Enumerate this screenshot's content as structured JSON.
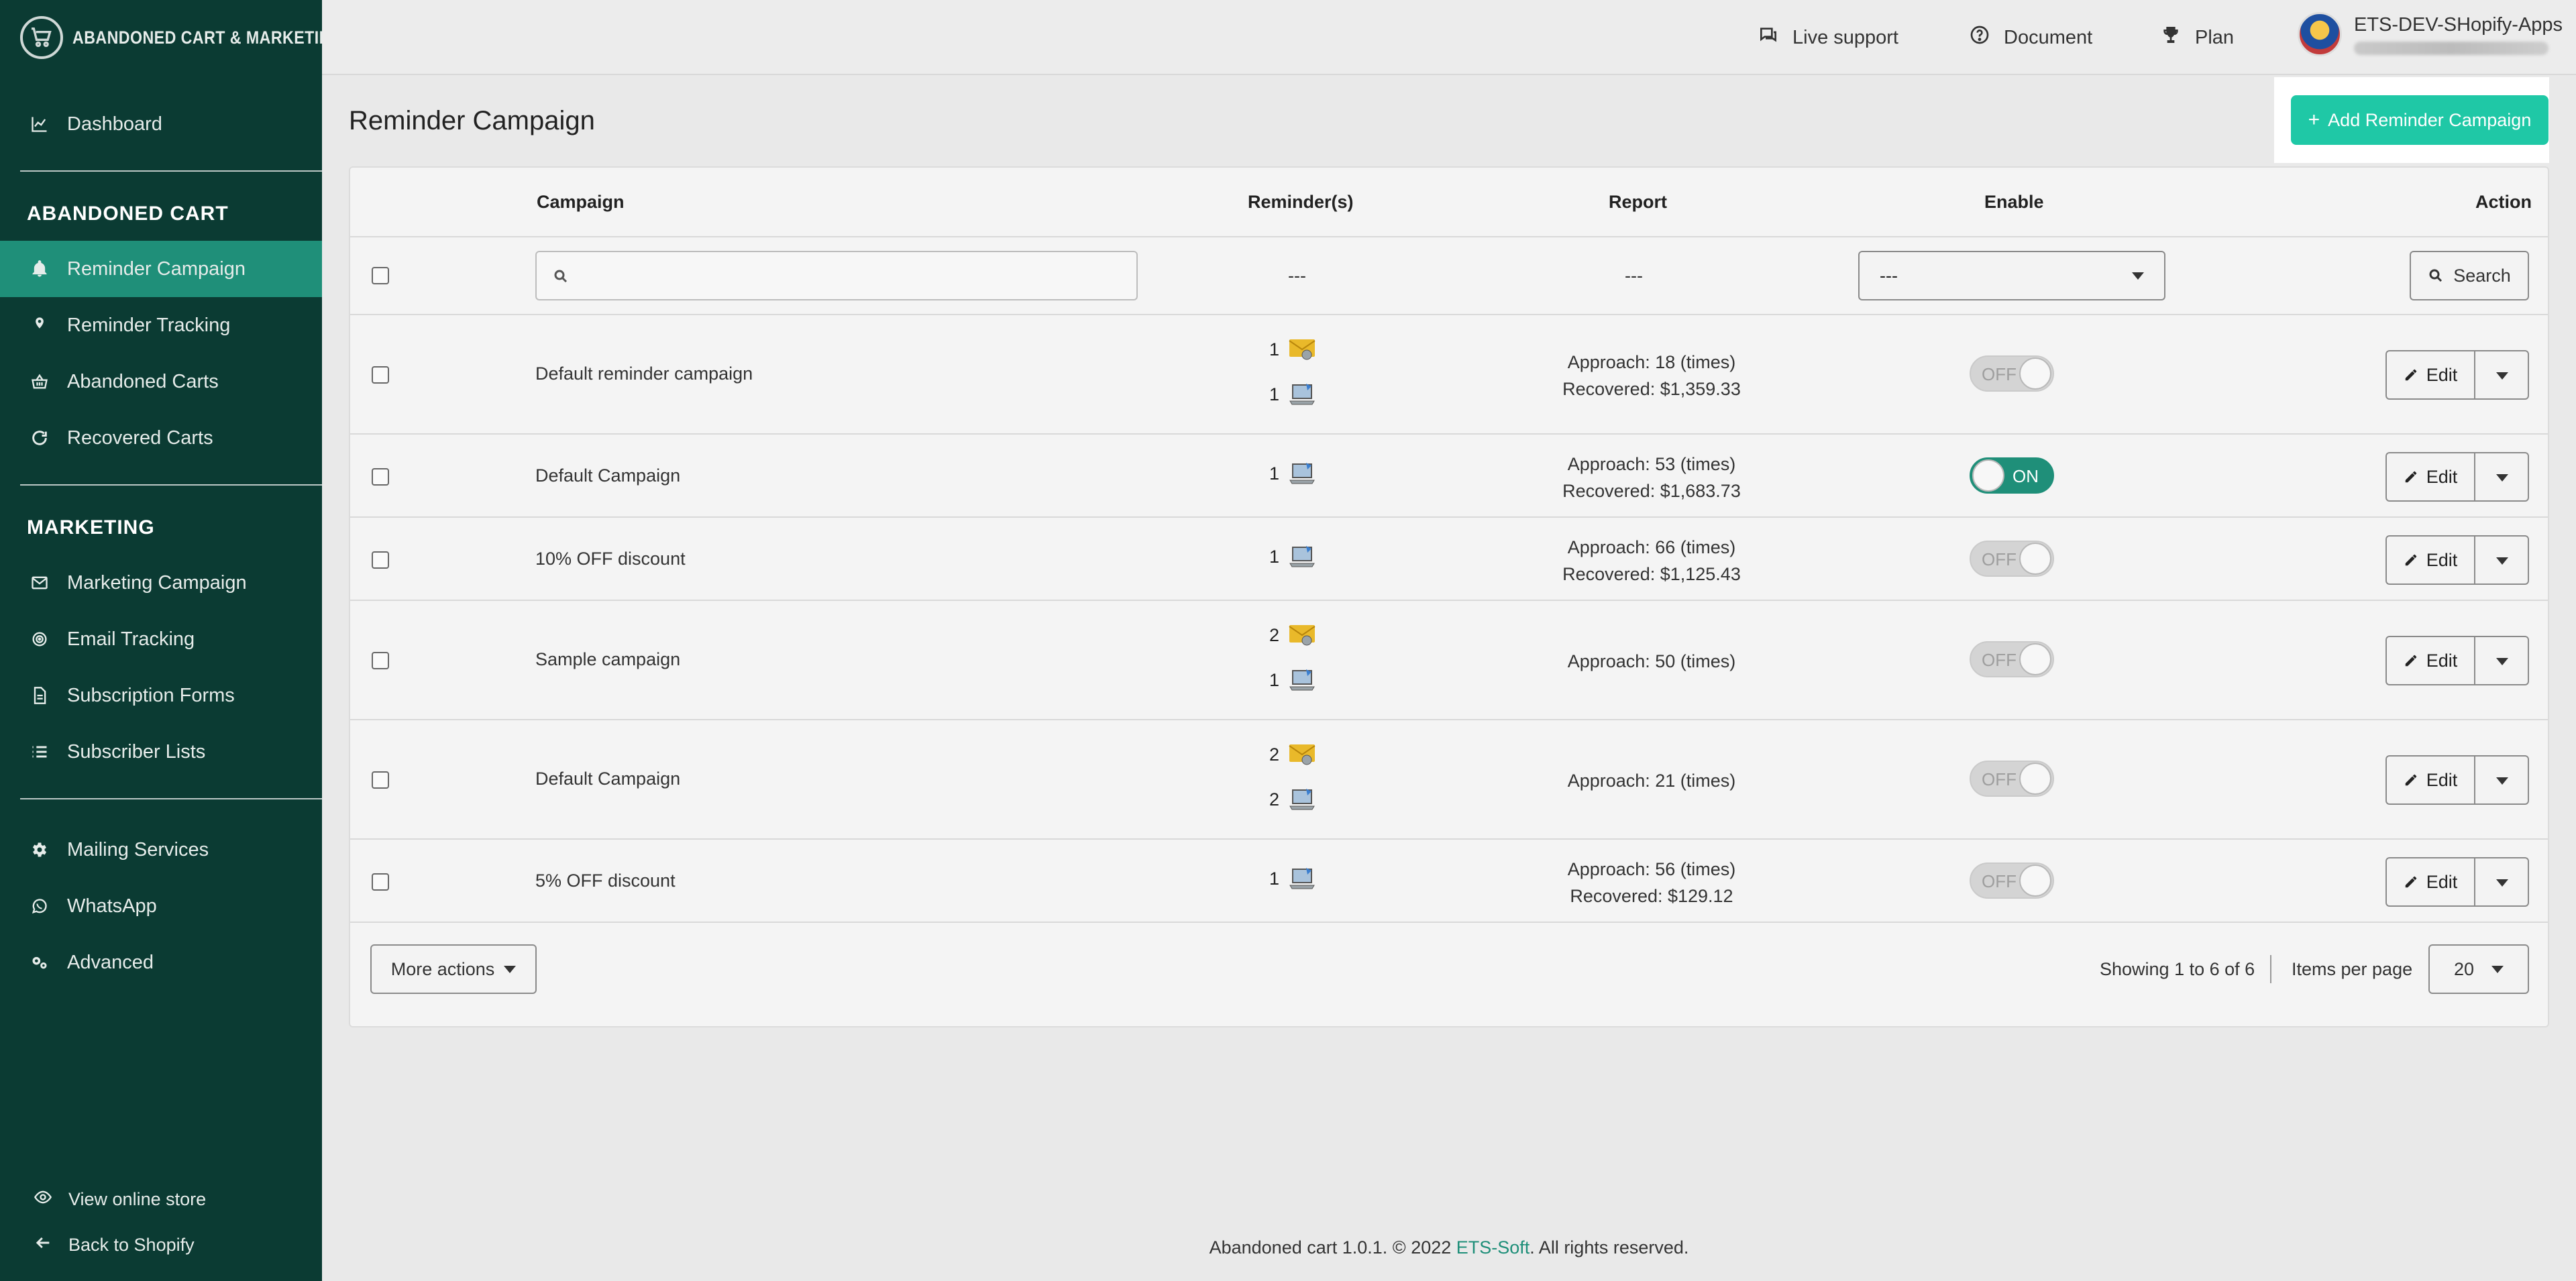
{
  "brand": {
    "name": "ABANDONED CART & MARKETING"
  },
  "sidebar": {
    "dashboard": "Dashboard",
    "section_cart": "ABANDONED CART",
    "cart_items": [
      "Reminder Campaign",
      "Reminder Tracking",
      "Abandoned Carts",
      "Recovered Carts"
    ],
    "section_marketing": "MARKETING",
    "marketing_items": [
      "Marketing Campaign",
      "Email Tracking",
      "Subscription Forms",
      "Subscriber Lists"
    ],
    "other_items": [
      "Mailing Services",
      "WhatsApp",
      "Advanced"
    ],
    "footer": {
      "view_store": "View online store",
      "back": "Back to Shopify"
    },
    "active": "Reminder Campaign"
  },
  "topbar": {
    "live_support": "Live support",
    "document": "Document",
    "plan": "Plan",
    "user_name": "ETS-DEV-SHopify-Apps"
  },
  "main": {
    "title": "Reminder Campaign",
    "add_button": "Add Reminder Campaign",
    "columns": {
      "campaign": "Campaign",
      "reminders": "Reminder(s)",
      "report": "Report",
      "enable": "Enable",
      "action": "Action"
    },
    "filter": {
      "reminders": "---",
      "report": "---",
      "enable_select": "---",
      "search_button": "Search"
    },
    "rows": [
      {
        "name": "Default reminder campaign",
        "email_count": "1",
        "popup_count": "1",
        "approach": "Approach: 18 (times)",
        "recovered": "Recovered: $1,359.33",
        "enabled": false,
        "toggle_label": "OFF",
        "edit": "Edit"
      },
      {
        "name": "Default Campaign",
        "email_count": "",
        "popup_count": "1",
        "approach": "Approach: 53 (times)",
        "recovered": "Recovered: $1,683.73",
        "enabled": true,
        "toggle_label": "ON",
        "edit": "Edit"
      },
      {
        "name": "10% OFF discount",
        "email_count": "",
        "popup_count": "1",
        "approach": "Approach: 66 (times)",
        "recovered": "Recovered: $1,125.43",
        "enabled": false,
        "toggle_label": "OFF",
        "edit": "Edit"
      },
      {
        "name": "Sample campaign",
        "email_count": "2",
        "popup_count": "1",
        "approach": "Approach: 50 (times)",
        "recovered": "",
        "enabled": false,
        "toggle_label": "OFF",
        "edit": "Edit"
      },
      {
        "name": "Default Campaign",
        "email_count": "2",
        "popup_count": "2",
        "approach": "Approach: 21 (times)",
        "recovered": "",
        "enabled": false,
        "toggle_label": "OFF",
        "edit": "Edit"
      },
      {
        "name": "5% OFF discount",
        "email_count": "",
        "popup_count": "1",
        "approach": "Approach: 56 (times)",
        "recovered": "Recovered: $129.12",
        "enabled": false,
        "toggle_label": "OFF",
        "edit": "Edit"
      }
    ],
    "more_actions": "More actions",
    "pagination": {
      "showing": "Showing 1 to 6 of 6",
      "items_per_page_label": "Items per page",
      "items_per_page": "20"
    }
  },
  "footer": {
    "prefix": "Abandoned cart 1.0.1. © 2022 ",
    "link": "ETS-Soft",
    "suffix": ". All rights reserved."
  },
  "colors": {
    "sidebar_bg": "#0b3b33",
    "accent": "#1fc8a6",
    "active_item": "#1f8f79"
  }
}
